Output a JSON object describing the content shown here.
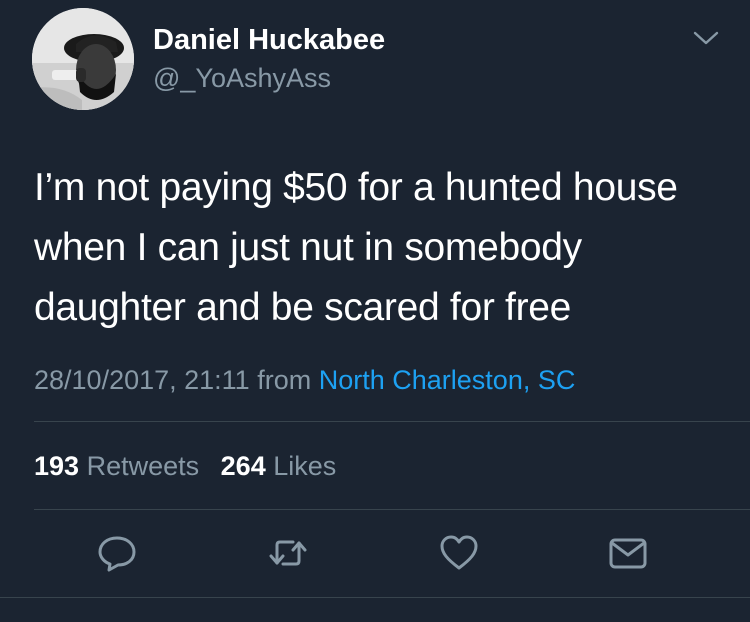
{
  "user": {
    "display_name": "Daniel Huckabee",
    "handle": "@_YoAshyAss",
    "avatar_icon": "profile-photo"
  },
  "tweet": {
    "lines": [
      "I’m not paying $50 for a hunted house",
      "when I can just nut in somebody",
      "daughter and be scared for free"
    ],
    "timestamp": "28/10/2017, 21:11",
    "from_label": "from",
    "location": "North Charleston, SC"
  },
  "stats": {
    "retweets_count": "193",
    "retweets_label": "Retweets",
    "likes_count": "264",
    "likes_label": "Likes"
  },
  "actions": {
    "reply_icon": "reply-icon",
    "retweet_icon": "retweet-icon",
    "like_icon": "heart-icon",
    "message_icon": "envelope-icon"
  },
  "colors": {
    "background": "#1b2431",
    "text": "#ffffff",
    "secondary": "#8899a6",
    "link": "#1da1f2",
    "divider": "#38444d"
  }
}
